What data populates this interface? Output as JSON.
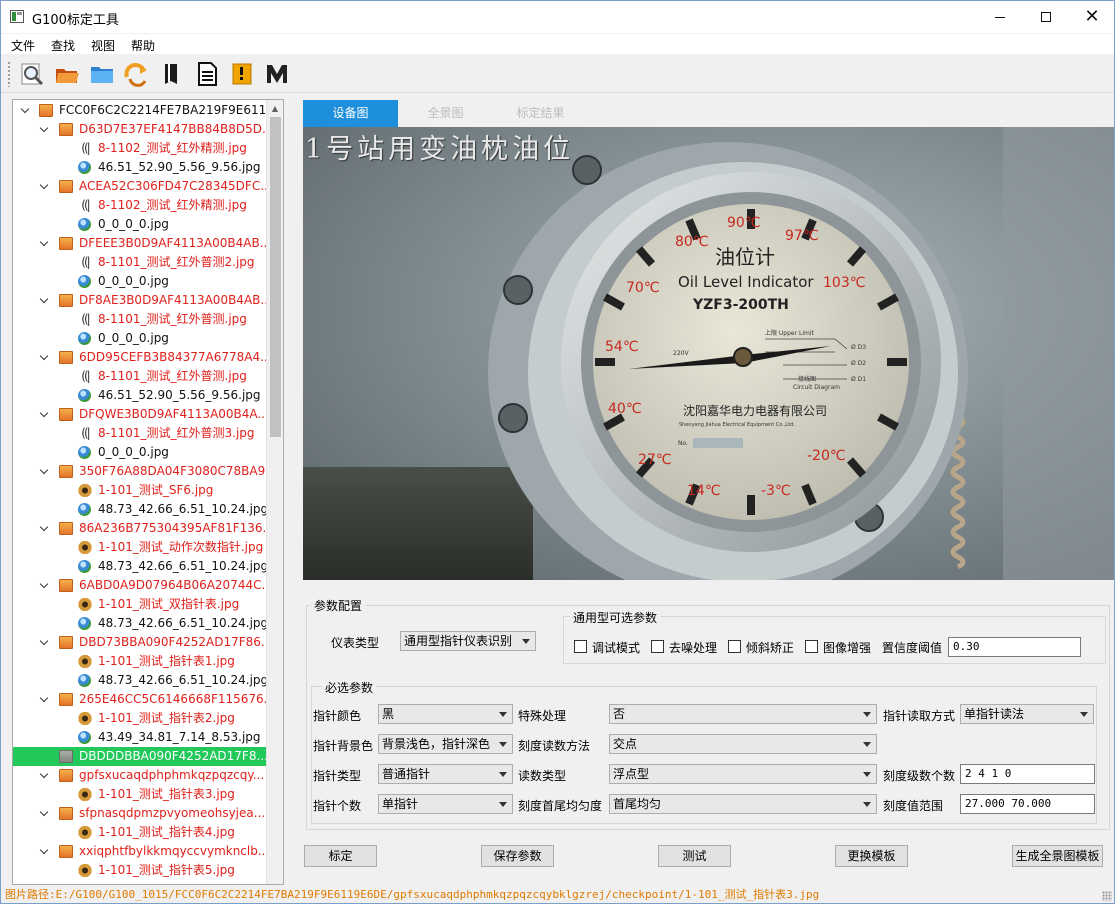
{
  "window": {
    "title": "G100标定工具"
  },
  "menu": [
    "文件",
    "查找",
    "视图",
    "帮助"
  ],
  "toolbar": {
    "icons": [
      "preview-icon",
      "open-folder-icon",
      "folder-icon",
      "refresh-icon",
      "book-icon",
      "document-icon",
      "bookmark-icon",
      "m-logo-icon"
    ]
  },
  "tree": {
    "root": "FCC0F6C2C2214FE7BA219F9E611...",
    "rows": [
      {
        "level": 1,
        "type": "folder",
        "text": "D63D7E37EF4147BB84B8D5D...",
        "color": "red"
      },
      {
        "level": 2,
        "type": "ir",
        "text": "8-1102_测试_红外精测.jpg",
        "color": "red"
      },
      {
        "level": 2,
        "type": "globe",
        "text": "46.51_52.90_5.56_9.56.jpg",
        "color": "black"
      },
      {
        "level": 1,
        "type": "folder",
        "text": "ACEA52C306FD47C28345DFC...",
        "color": "red"
      },
      {
        "level": 2,
        "type": "ir",
        "text": "8-1102_测试_红外精测.jpg",
        "color": "red"
      },
      {
        "level": 2,
        "type": "globe",
        "text": "0_0_0_0.jpg",
        "color": "black"
      },
      {
        "level": 1,
        "type": "folder",
        "text": "DFEEE3B0D9AF4113A00B4AB...",
        "color": "red"
      },
      {
        "level": 2,
        "type": "ir",
        "text": "8-1101_测试_红外普测2.jpg",
        "color": "red"
      },
      {
        "level": 2,
        "type": "globe",
        "text": "0_0_0_0.jpg",
        "color": "black"
      },
      {
        "level": 1,
        "type": "folder",
        "text": "DF8AE3B0D9AF4113A00B4AB...",
        "color": "red"
      },
      {
        "level": 2,
        "type": "ir",
        "text": "8-1101_测试_红外普测.jpg",
        "color": "red"
      },
      {
        "level": 2,
        "type": "globe",
        "text": "0_0_0_0.jpg",
        "color": "black"
      },
      {
        "level": 1,
        "type": "folder",
        "text": "6DD95CEFB3B84377A6778A4...",
        "color": "red"
      },
      {
        "level": 2,
        "type": "ir",
        "text": "8-1101_测试_红外普测.jpg",
        "color": "red"
      },
      {
        "level": 2,
        "type": "globe",
        "text": "46.51_52.90_5.56_9.56.jpg",
        "color": "black"
      },
      {
        "level": 1,
        "type": "folder",
        "text": "DFQWE3B0D9AF4113A00B4A...",
        "color": "red"
      },
      {
        "level": 2,
        "type": "ir",
        "text": "8-1101_测试_红外普测3.jpg",
        "color": "red"
      },
      {
        "level": 2,
        "type": "globe",
        "text": "0_0_0_0.jpg",
        "color": "black"
      },
      {
        "level": 1,
        "type": "folder",
        "text": "350F76A88DA04F3080C78BA9...",
        "color": "red"
      },
      {
        "level": 2,
        "type": "dog",
        "text": "1-101_测试_SF6.jpg",
        "color": "red"
      },
      {
        "level": 2,
        "type": "globe",
        "text": "48.73_42.66_6.51_10.24.jpg",
        "color": "black"
      },
      {
        "level": 1,
        "type": "folder",
        "text": "86A236B775304395AF81F136...",
        "color": "red"
      },
      {
        "level": 2,
        "type": "dog",
        "text": "1-101_测试_动作次数指针.jpg",
        "color": "red"
      },
      {
        "level": 2,
        "type": "globe",
        "text": "48.73_42.66_6.51_10.24.jpg",
        "color": "black"
      },
      {
        "level": 1,
        "type": "folder",
        "text": "6ABD0A9D07964B06A20744C...",
        "color": "red"
      },
      {
        "level": 2,
        "type": "dog",
        "text": "1-101_测试_双指针表.jpg",
        "color": "red"
      },
      {
        "level": 2,
        "type": "globe",
        "text": "48.73_42.66_6.51_10.24.jpg",
        "color": "black"
      },
      {
        "level": 1,
        "type": "folder",
        "text": "DBD73BBA090F4252AD17F86...",
        "color": "red"
      },
      {
        "level": 2,
        "type": "dog",
        "text": "1-101_测试_指针表1.jpg",
        "color": "red"
      },
      {
        "level": 2,
        "type": "globe",
        "text": "48.73_42.66_6.51_10.24.jpg",
        "color": "black"
      },
      {
        "level": 1,
        "type": "folder",
        "text": "265E46CC5C6146668F115676...",
        "color": "red"
      },
      {
        "level": 2,
        "type": "dog",
        "text": "1-101_测试_指针表2.jpg",
        "color": "red"
      },
      {
        "level": 2,
        "type": "globe",
        "text": "43.49_34.81_7.14_8.53.jpg",
        "color": "black"
      },
      {
        "level": 1,
        "type": "folder-gray",
        "text": "DBDDDBBA090F4252AD17F8...",
        "color": "white",
        "selected": true,
        "nochev": true
      },
      {
        "level": 1,
        "type": "folder",
        "text": "gpfsxucaqdphphmkqzpqzcqy...",
        "color": "red"
      },
      {
        "level": 2,
        "type": "dog",
        "text": "1-101_测试_指针表3.jpg",
        "color": "red"
      },
      {
        "level": 1,
        "type": "folder",
        "text": "sfpnasqdpmzpvyomeohsyjea...",
        "color": "red"
      },
      {
        "level": 2,
        "type": "dog",
        "text": "1-101_测试_指针表4.jpg",
        "color": "red"
      },
      {
        "level": 1,
        "type": "folder",
        "text": "xxiqphtfbylkkmqyccvymknclb...",
        "color": "red"
      },
      {
        "level": 2,
        "type": "dog",
        "text": "1-101_测试_指针表5.jpg",
        "color": "red"
      }
    ]
  },
  "tabs": [
    {
      "label": "设备图",
      "active": true
    },
    {
      "label": "全景图",
      "active": false
    },
    {
      "label": "标定结果",
      "active": false
    }
  ],
  "image": {
    "caption": "1号站用变油枕油位",
    "gauge_title_cn": "油位计",
    "gauge_title_en": "Oil Level Indicator",
    "gauge_model": "YZF3-200TH",
    "maker_cn": "沈阳嘉华电力电器有限公司",
    "maker_en": "Shenyang Jiahua Electrical Equipment Co.,Ltd.",
    "scale": [
      "90℃",
      "97℃",
      "80℃",
      "103℃",
      "70℃",
      "54℃",
      "40℃",
      "27℃",
      "14℃",
      "-3℃",
      "-20℃"
    ],
    "inset_labels": [
      "上限 Upper Limit",
      "Ø D3",
      "Ø D2",
      "Ø D1",
      "接线图",
      "Circuit Diagram",
      "220V"
    ]
  },
  "params": {
    "title": "参数配置",
    "meter_type_label": "仪表类型",
    "meter_type_value": "通用型指针仪表识别",
    "optional": {
      "title": "通用型可选参数",
      "checks": [
        "调试模式",
        "去噪处理",
        "倾斜矫正",
        "图像增强"
      ],
      "threshold_label": "置信度阈值",
      "threshold_value": "0.30"
    },
    "required": {
      "title": "必选参数",
      "fields": {
        "pointer_color_label": "指针颜色",
        "pointer_color_value": "黑",
        "special_label": "特殊处理",
        "special_value": "否",
        "read_mode_label": "指针读取方式",
        "read_mode_value": "单指针读法",
        "bg_color_label": "指针背景色",
        "bg_color_value": "背景浅色，指针深色",
        "scale_method_label": "刻度读数方法",
        "scale_method_value": "交点",
        "pointer_type_label": "指针类型",
        "pointer_type_value": "普通指针",
        "read_type_label": "读数类型",
        "read_type_value": "浮点型",
        "scale_levels_label": "刻度级数个数",
        "scale_levels_value": "2 4 1 0",
        "pointer_count_label": "指针个数",
        "pointer_count_value": "单指针",
        "uniformity_label": "刻度首尾均匀度",
        "uniformity_value": "首尾均匀",
        "range_label": "刻度值范围",
        "range_value": "27.000 70.000"
      }
    }
  },
  "buttons": [
    "标定",
    "保存参数",
    "测试",
    "更换模板",
    "生成全景图模板"
  ],
  "status": "图片路径:E:/G100/G100_1015/FCC0F6C2C2214FE7BA219F9E6119E6DE/gpfsxucaqdphphmkqzpqzcqybklgzrej/checkpoint/1-101_测试_指针表3.jpg",
  "colors": {
    "accent_tab": "#1e8fdc",
    "selected_row": "#22c85a",
    "tree_red": "#e0201b",
    "status_orange": "#e07a00"
  }
}
